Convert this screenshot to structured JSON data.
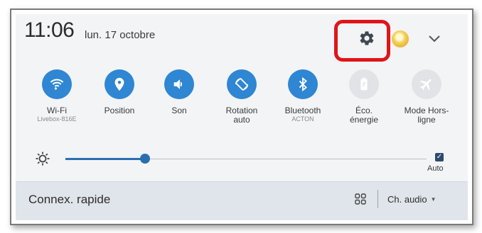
{
  "status": {
    "time": "11:06",
    "date": "lun. 17 octobre"
  },
  "header": {
    "settings_icon": "gear-icon",
    "avatar_icon": "lightbulb-avatar",
    "expand_icon": "chevron-down-icon",
    "highlight_color": "#e0141b"
  },
  "toggles": [
    {
      "label": "Wi-Fi",
      "sub": "Livebox-816E",
      "icon": "wifi-icon",
      "on": true
    },
    {
      "label": "Position",
      "sub": "",
      "icon": "location-pin-icon",
      "on": true
    },
    {
      "label": "Son",
      "sub": "",
      "icon": "volume-icon",
      "on": true
    },
    {
      "label": "Rotation auto",
      "sub": "",
      "icon": "rotation-icon",
      "on": true
    },
    {
      "label": "Bluetooth",
      "sub": "ACTON",
      "icon": "bluetooth-icon",
      "on": true
    },
    {
      "label": "Éco. énergie",
      "sub": "",
      "icon": "battery-saver-icon",
      "on": false
    },
    {
      "label": "Mode Hors-ligne",
      "sub": "",
      "icon": "airplane-icon",
      "on": false
    }
  ],
  "brightness": {
    "level": 0.22,
    "auto_label": "Auto",
    "auto_checked": true
  },
  "footer": {
    "connex_label": "Connex. rapide",
    "audio_label": "Ch. audio"
  },
  "colors": {
    "accent": "#2f86d2",
    "off": "#e1e3e6"
  }
}
